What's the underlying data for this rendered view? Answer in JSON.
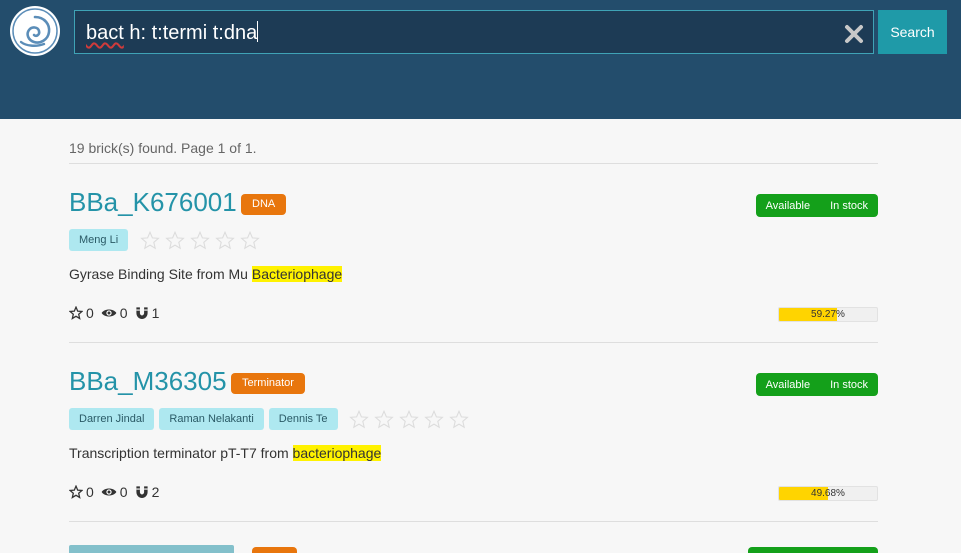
{
  "search": {
    "query_parts": [
      "bact",
      " h: t:termi t:dna"
    ],
    "button_label": "Search"
  },
  "results_summary": "19 brick(s) found. Page 1 of 1.",
  "results": [
    {
      "name": "BBa_K676001",
      "type": "DNA",
      "status": [
        "Available",
        "In stock"
      ],
      "authors": [
        "Meng Li"
      ],
      "rating_stars": 5,
      "description_before": "Gyrase Binding Site from Mu ",
      "description_highlight": "Bacteriophage",
      "favorites": "0",
      "watchers": "0",
      "uses": "1",
      "progress_label": "59.27%",
      "progress_value": 59.27
    },
    {
      "name": "BBa_M36305",
      "type": "Terminator",
      "status": [
        "Available",
        "In stock"
      ],
      "authors": [
        "Darren Jindal",
        "Raman Nelakanti",
        "Dennis Te"
      ],
      "rating_stars": 5,
      "description_before": "Transcription terminator pT-T7 from ",
      "description_highlight": "bacteriophage",
      "favorites": "0",
      "watchers": "0",
      "uses": "2",
      "progress_label": "49.68%",
      "progress_value": 49.68
    }
  ]
}
